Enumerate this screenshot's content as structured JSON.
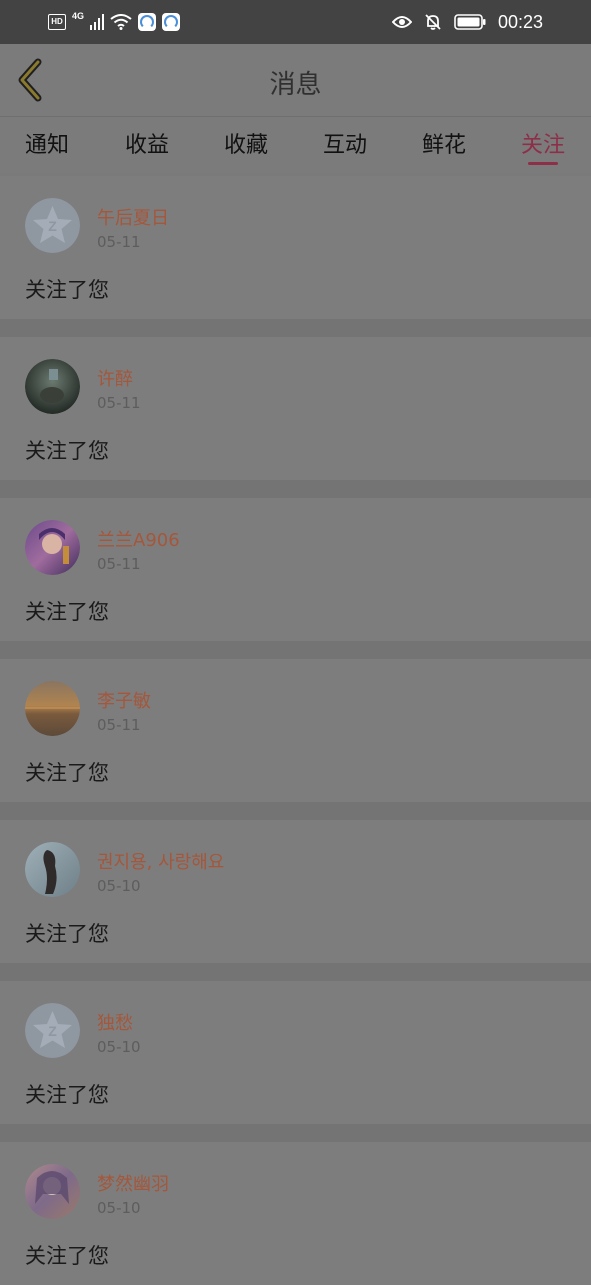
{
  "status_bar": {
    "hd_label": "HD",
    "network_label": "4G",
    "time": "00:23"
  },
  "header": {
    "title": "消息",
    "back_icon": "chevron-left-icon"
  },
  "tabs": [
    {
      "label": "通知",
      "active": false
    },
    {
      "label": "收益",
      "active": false
    },
    {
      "label": "收藏",
      "active": false
    },
    {
      "label": "互动",
      "active": false
    },
    {
      "label": "鲜花",
      "active": false
    },
    {
      "label": "关注",
      "active": true
    }
  ],
  "colors": {
    "accent": "#8e2f4a",
    "username": "#a4573b"
  },
  "notifications": [
    {
      "username": "午后夏日",
      "date": "05-11",
      "message": "关注了您",
      "avatar": "default-qq-star"
    },
    {
      "username": "许醉",
      "date": "05-11",
      "message": "关注了您",
      "avatar": "photo-dark"
    },
    {
      "username": "兰兰A906",
      "date": "05-11",
      "message": "关注了您",
      "avatar": "photo-anime-purple"
    },
    {
      "username": "李子敏",
      "date": "05-11",
      "message": "关注了您",
      "avatar": "photo-sunset"
    },
    {
      "username": "권지용, 사랑해요",
      "date": "05-10",
      "message": "关注了您",
      "avatar": "photo-figure"
    },
    {
      "username": "独愁",
      "date": "05-10",
      "message": "关注了您",
      "avatar": "default-qq-star"
    },
    {
      "username": "梦然幽羽",
      "date": "05-10",
      "message": "关注了您",
      "avatar": "photo-anime-pink"
    }
  ]
}
